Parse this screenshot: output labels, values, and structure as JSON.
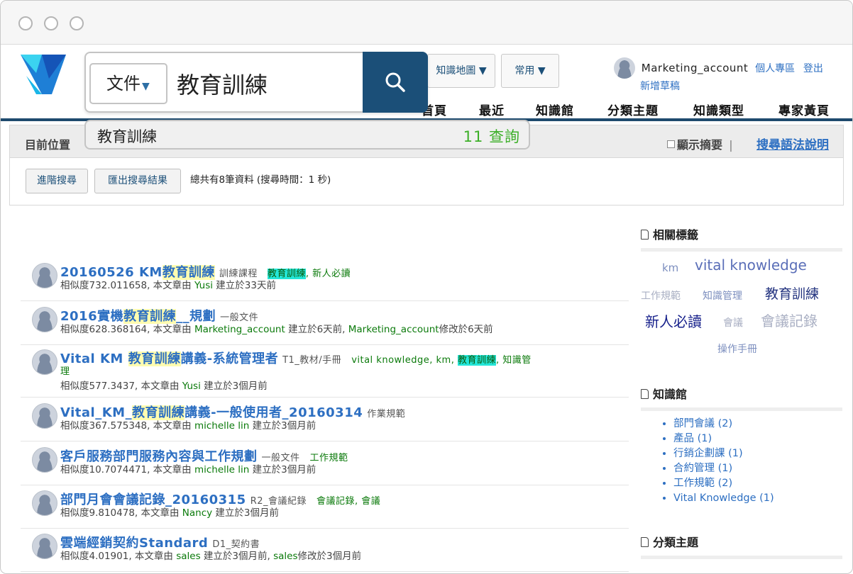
{
  "search": {
    "doc_type": "文件",
    "query": "教育訓練",
    "suggestion": {
      "text": "教育訓練",
      "count": "11 查詢"
    }
  },
  "nav_buttons": [
    "知識地圖 ▼",
    "常用 ▼"
  ],
  "user": {
    "name": "Marketing_account",
    "personal": "個人專區",
    "logout": "登出",
    "new_draft": "新增草稿"
  },
  "top_nav": [
    "首頁",
    "最近",
    "知識館",
    "分類主題",
    "知識類型",
    "專家黃頁"
  ],
  "location_label": "目前位置",
  "show_summary": "顯示摘要",
  "separator": "|",
  "syntax_help": "搜尋語法說明",
  "buttons": {
    "advanced": "進階搜尋",
    "export": "匯出搜尋結果"
  },
  "result_summary": "總共有8筆資料 (搜尋時間：1 秒)",
  "results": [
    {
      "pre": "20160526 KM",
      "hl": "教育訓練",
      "post": "",
      "category": "訓練課程",
      "tags": [
        {
          "t": "教育訓練",
          "hl": true
        },
        {
          "t": ", ",
          "sep": true
        },
        {
          "t": "新人必讀"
        }
      ],
      "meta": {
        "score": "相似度732.011658, 本文章由 ",
        "author": "Yusi",
        "rest": " 建立於33天前"
      }
    },
    {
      "pre": "2016實機",
      "hl": "教育訓練",
      "post": "__規劃",
      "category": "一般文件",
      "tags": [],
      "meta": {
        "score": "相似度628.368164, 本文章由 ",
        "author": "Marketing_account",
        "rest": " 建立於6天前, ",
        "editor": "Marketing_account",
        "rest2": "修改於6天前"
      }
    },
    {
      "pre": "Vital KM ",
      "hl": "教育訓練",
      "post": "講義-系統管理者",
      "category": "T1_教材/手冊",
      "tags": [
        {
          "t": "vital knowledge"
        },
        {
          "t": ", ",
          "sep": true
        },
        {
          "t": "km"
        },
        {
          "t": ", ",
          "sep": true
        },
        {
          "t": "教育訓練",
          "hl": true
        },
        {
          "t": ", ",
          "sep": true
        },
        {
          "t": "知識管"
        }
      ],
      "tag_wrap": "理",
      "meta": {
        "score": "相似度577.3437, 本文章由 ",
        "author": "Yusi",
        "rest": " 建立於3個月前"
      }
    },
    {
      "pre": "Vital_KM_",
      "hl": "教育訓練",
      "post": "講義-一般使用者_20160314",
      "category": "作業規範",
      "tags": [],
      "meta": {
        "score": "相似度367.575348, 本文章由 ",
        "author": "michelle lin",
        "rest": " 建立於3個月前"
      }
    },
    {
      "pre": "客戶服務部門服務內容與工作規劃",
      "hl": "",
      "post": "",
      "category": "一般文件",
      "tags": [
        {
          "t": "工作規範"
        }
      ],
      "meta": {
        "score": "相似度10.7074471, 本文章由 ",
        "author": "michelle lin",
        "rest": " 建立於3個月前"
      }
    },
    {
      "pre": "部門月會會議記錄_20160315",
      "hl": "",
      "post": "",
      "category": "R2_會議紀錄",
      "tags": [
        {
          "t": "會議記錄"
        },
        {
          "t": ", ",
          "sep": true
        },
        {
          "t": "會議"
        }
      ],
      "meta": {
        "score": "相似度9.810478, 本文章由 ",
        "author": "Nancy",
        "rest": " 建立於3個月前"
      }
    },
    {
      "pre": "雲端經銷契約Standard",
      "hl": "",
      "post": "",
      "category": "D1_契約書",
      "tags": [],
      "meta": {
        "score": "相似度4.01901, 本文章由 ",
        "author": "sales",
        "rest": " 建立於3個月前, ",
        "editor": "sales",
        "rest2": "修改於3個月前"
      }
    }
  ],
  "sidebar": {
    "related_tags_title": "相關標籤",
    "tags": [
      {
        "t": "km",
        "color": "#7d8fbf"
      },
      {
        "t": "vital knowledge",
        "color": "#5b6fb8"
      },
      {
        "t": "工作規範",
        "color": "#a9afc3"
      },
      {
        "t": "知識管理",
        "color": "#7d8fbf"
      },
      {
        "t": "教育訓練",
        "color": "#23337f"
      },
      {
        "t": "新人必讀",
        "color": "#141e8a"
      },
      {
        "t": "會議",
        "color": "#a9afc3"
      },
      {
        "t": "會議記錄",
        "color": "#a9afc3"
      },
      {
        "t": "操作手冊",
        "color": "#7d8fbf"
      }
    ],
    "km_hall_title": "知識館",
    "km_hall": [
      "部門會議 (2)",
      "產品 (1)",
      "行銷企劃課 (1)",
      "合約管理 (1)",
      "工作規範 (2)",
      "Vital Knowledge (1)"
    ],
    "category_title": "分類主題"
  }
}
